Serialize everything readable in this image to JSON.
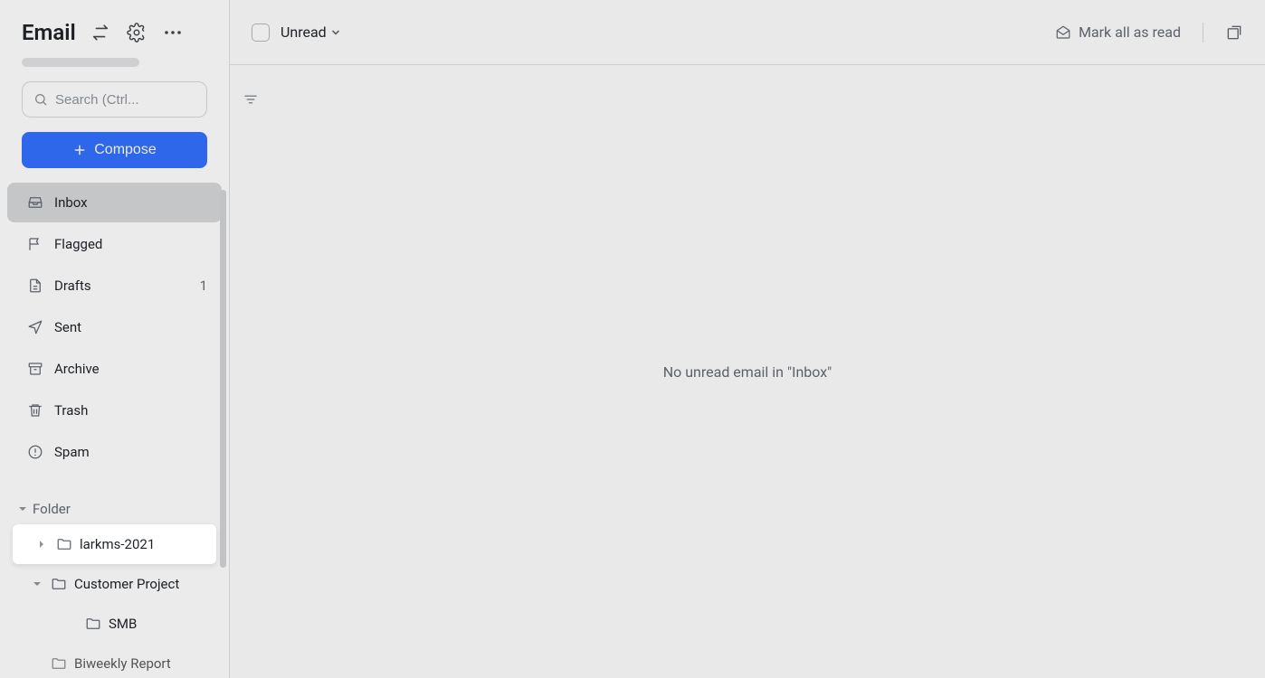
{
  "header": {
    "title": "Email"
  },
  "search": {
    "placeholder": "Search (Ctrl..."
  },
  "compose": {
    "label": "Compose"
  },
  "nav": {
    "inbox": {
      "label": "Inbox"
    },
    "flagged": {
      "label": "Flagged"
    },
    "drafts": {
      "label": "Drafts",
      "count": "1"
    },
    "sent": {
      "label": "Sent"
    },
    "archive": {
      "label": "Archive"
    },
    "trash": {
      "label": "Trash"
    },
    "spam": {
      "label": "Spam"
    }
  },
  "folders": {
    "section_label": "Folder",
    "items": {
      "larkms": "larkms-2021",
      "customer_project": "Customer Project",
      "smb": "SMB",
      "biweekly_report": "Biweekly Report"
    }
  },
  "topbar": {
    "filter_label": "Unread",
    "mark_all_read": "Mark all as read"
  },
  "empty_state": "No unread email in \"Inbox\""
}
